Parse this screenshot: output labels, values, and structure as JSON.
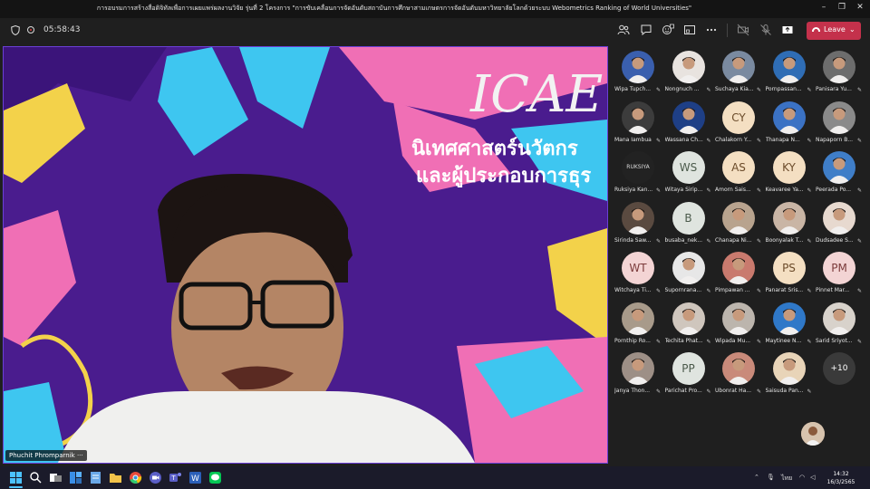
{
  "window": {
    "title": "การอบรมการสร้างสื่อดิจิทัลเพื่อการเผยแพร่ผลงานวิจัย รุ่นที่ 2 โครงการ \"การขับเคลื่อนการจัดอันดับสถาบันการศึกษาสามเกษตรการจัดอันดับมหาวิทยาลัยโลกด้วยระบบ Webometrics Ranking of World Universities\"",
    "controls": {
      "minimize": "–",
      "restore": "❐",
      "close": "✕"
    }
  },
  "toolbar": {
    "timer": "05:58:43",
    "icons": [
      "people-icon",
      "chat-icon",
      "reactions-icon",
      "rooms-icon",
      "more-icon",
      "camera-off-icon",
      "mic-off-icon",
      "share-icon"
    ],
    "leave_label": "Leave"
  },
  "stage": {
    "presenter_name": "Phuchit Phromparnik",
    "slide_logo": "ICAE",
    "slide_line1": "นิเทศศาสตร์นวัตกร",
    "slide_line2": "และผู้ประกอบการธุร"
  },
  "participants": [
    {
      "name": "Wipa Tupch...",
      "type": "photo",
      "color": "#3a5fae"
    },
    {
      "name": "Nongnuch ...",
      "type": "photo",
      "color": "#e8e3df"
    },
    {
      "name": "Suchaya Kia...",
      "type": "photo",
      "color": "#7a8aa0"
    },
    {
      "name": "Pornpassan...",
      "type": "photo",
      "color": "#2f6db5"
    },
    {
      "name": "Panisara Yu...",
      "type": "photo",
      "color": "#6d6d6d"
    },
    {
      "name": "Mana Iambua",
      "type": "photo",
      "color": "#3c3c3c"
    },
    {
      "name": "Wassana Ch...",
      "type": "photo",
      "color": "#1e3f86"
    },
    {
      "name": "Chalakorn Y...",
      "type": "initials",
      "initials": "CY",
      "tone": "init"
    },
    {
      "name": "Thanapa N...",
      "type": "photo",
      "color": "#3b72c4"
    },
    {
      "name": "Napaporn B...",
      "type": "photo",
      "color": "#8a8a8a"
    },
    {
      "name": "Ruksiya Kan...",
      "type": "initials",
      "initials": "RUKSIYA",
      "tone": "dark"
    },
    {
      "name": "Witaya Sirip...",
      "type": "initials",
      "initials": "WS",
      "tone": "gray"
    },
    {
      "name": "Amorn Sais...",
      "type": "initials",
      "initials": "AS",
      "tone": "init"
    },
    {
      "name": "Keavaree Ya...",
      "type": "initials",
      "initials": "KY",
      "tone": "init"
    },
    {
      "name": "Peerada Po...",
      "type": "photo",
      "color": "#3f7ec8"
    },
    {
      "name": "Sirinda Saw...",
      "type": "photo",
      "color": "#5a4a40"
    },
    {
      "name": "busaba_nek...",
      "type": "initials",
      "initials": "B",
      "tone": "gray"
    },
    {
      "name": "Chanapa Ni...",
      "type": "photo",
      "color": "#b8a38e"
    },
    {
      "name": "Boonyalak T...",
      "type": "photo",
      "color": "#c9b5a5"
    },
    {
      "name": "Dudsadee S...",
      "type": "photo",
      "color": "#e7d9cf"
    },
    {
      "name": "Witchaya Ti...",
      "type": "initials",
      "initials": "WT",
      "tone": "pink"
    },
    {
      "name": "Supornrana...",
      "type": "photo",
      "color": "#e7e7e7"
    },
    {
      "name": "Pimpawan ...",
      "type": "photo",
      "color": "#c97a6e"
    },
    {
      "name": "Panarat Sris...",
      "type": "initials",
      "initials": "PS",
      "tone": "init"
    },
    {
      "name": "Pinnet Mar...",
      "type": "initials",
      "initials": "PM",
      "tone": "pink"
    },
    {
      "name": "Pornthip Ro...",
      "type": "photo",
      "color": "#a89a8a"
    },
    {
      "name": "Techita Phat...",
      "type": "photo",
      "color": "#cfc6bd"
    },
    {
      "name": "Wipada Mu...",
      "type": "photo",
      "color": "#bcb5ad"
    },
    {
      "name": "Maytinee N...",
      "type": "photo",
      "color": "#2f78c8"
    },
    {
      "name": "Sarid Sriyot...",
      "type": "photo",
      "color": "#d8d2cb"
    },
    {
      "name": "Janya Thon...",
      "type": "photo",
      "color": "#9d8f86"
    },
    {
      "name": "Parichat Pro...",
      "type": "initials",
      "initials": "PP",
      "tone": "gray"
    },
    {
      "name": "Ubonrat Ha...",
      "type": "photo",
      "color": "#c98a7a"
    },
    {
      "name": "Saisuda Pan...",
      "type": "photo",
      "color": "#e8d4b8"
    },
    {
      "name": "",
      "type": "more",
      "initials": "+10"
    }
  ],
  "taskbar": {
    "apps": [
      "windows-start-icon",
      "search-icon",
      "taskview-icon",
      "widgets-icon",
      "notepad-icon",
      "file-explorer-icon",
      "chrome-icon",
      "zoom-icon",
      "teams-icon",
      "word-icon",
      "line-icon"
    ],
    "tray_lang": "ไทย",
    "time": "14:32",
    "date": "16/3/2565"
  }
}
